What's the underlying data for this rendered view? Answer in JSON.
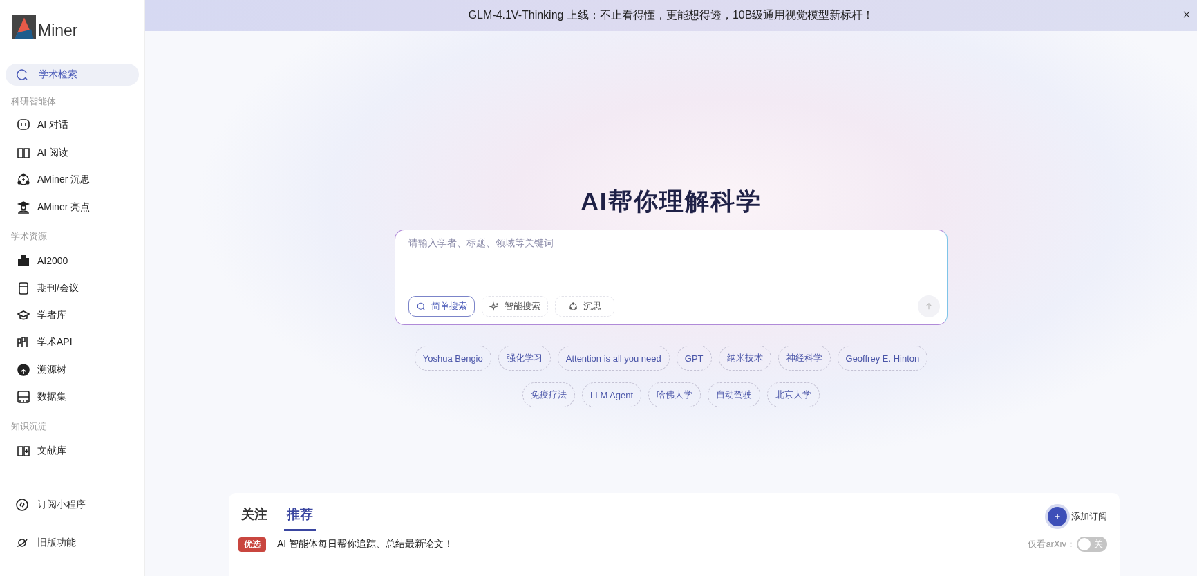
{
  "sidebar": {
    "logo_text": "Miner",
    "top_item": {
      "label": "学术检索",
      "selected": true
    },
    "sections": [
      {
        "title": "科研智能体",
        "items": [
          {
            "label": "AI 对话",
            "selected": false
          },
          {
            "label": "AI 阅读",
            "selected": false
          },
          {
            "label": "AMiner 沉思",
            "selected": false
          },
          {
            "label": "AMiner 亮点",
            "selected": false
          }
        ]
      },
      {
        "title": "学术资源",
        "items": [
          {
            "label": "AI2000",
            "selected": false
          },
          {
            "label": "期刊/会议",
            "selected": false
          },
          {
            "label": "学者库",
            "selected": false
          },
          {
            "label": "学术API",
            "selected": false
          },
          {
            "label": "溯源树",
            "selected": false
          },
          {
            "label": "数据集",
            "selected": false
          }
        ]
      },
      {
        "title": "知识沉淀",
        "items": [
          {
            "label": "文献库",
            "selected": false
          }
        ]
      }
    ],
    "bottom_items": [
      {
        "label": "订阅小程序"
      },
      {
        "label": "旧版功能"
      }
    ]
  },
  "banner": {
    "text": "GLM-4.1V-Thinking 上线：不止看得懂，更能想得透，10B级通用视觉模型新标杆！"
  },
  "hero": {
    "title": "AI帮你理解科学"
  },
  "search": {
    "placeholder": "请输入学者、标题、领域等关键词",
    "modes": [
      {
        "label": "简单搜索",
        "selected": true
      },
      {
        "label": "智能搜索",
        "selected": false
      },
      {
        "label": "沉思",
        "selected": false
      }
    ],
    "suggestions": [
      [
        "Yoshua Bengio",
        "强化学习",
        "Attention is all you need",
        "GPT",
        "纳米技术",
        "神经科学",
        "Geoffrey E. Hinton"
      ],
      [
        "免疫疗法",
        "LLM Agent",
        "哈佛大学",
        "自动驾驶",
        "北京大学"
      ]
    ]
  },
  "feed": {
    "tabs": [
      {
        "label": "关注",
        "selected": false
      },
      {
        "label": "推荐",
        "selected": true
      }
    ],
    "add_button": "添加订阅",
    "tag": "优选",
    "message": "AI 智能体每日帮你追踪、总结最新论文！",
    "arxiv_label": "仅看arXiv：",
    "arxiv_toggle": {
      "on": false,
      "label": "关"
    }
  }
}
